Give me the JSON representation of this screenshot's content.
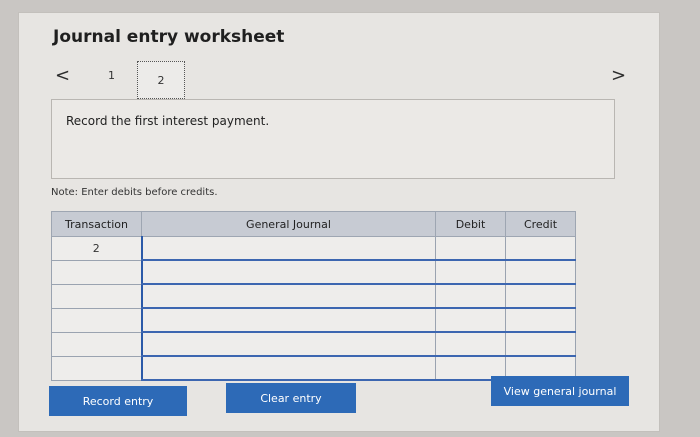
{
  "worksheet": {
    "title": "Journal entry worksheet",
    "nav_prev": "<",
    "nav_next": ">",
    "pages": [
      "1",
      "2"
    ]
  },
  "prompt": {
    "text": "Record the first interest payment."
  },
  "note": "Note: Enter debits before credits.",
  "table": {
    "headers": [
      "Transaction",
      "General Journal",
      "Debit",
      "Credit"
    ],
    "rows": [
      {
        "transaction": "2",
        "account": "",
        "debit": "",
        "credit": ""
      },
      {
        "transaction": "",
        "account": "",
        "debit": "",
        "credit": ""
      },
      {
        "transaction": "",
        "account": "",
        "debit": "",
        "credit": ""
      },
      {
        "transaction": "",
        "account": "",
        "debit": "",
        "credit": ""
      },
      {
        "transaction": "",
        "account": "",
        "debit": "",
        "credit": ""
      },
      {
        "transaction": "",
        "account": "",
        "debit": "",
        "credit": ""
      }
    ]
  },
  "buttons": {
    "record": "Record entry",
    "clear": "Clear entry",
    "view": "View general journal"
  },
  "colors": {
    "button": "#2d6ab7",
    "header": "#c7cbd3"
  }
}
